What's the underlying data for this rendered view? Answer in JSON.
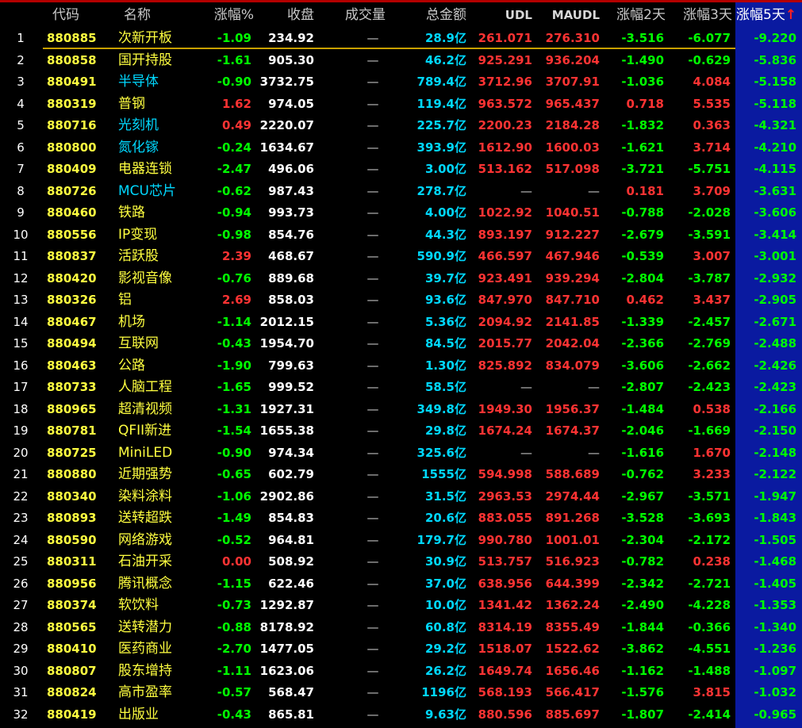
{
  "headers": {
    "code": "代码",
    "name": "名称",
    "change_pct": "涨幅%",
    "close": "收盘",
    "volume": "成交量",
    "total_amount": "总金额",
    "udl": "UDL",
    "maudl": "MAUDL",
    "change_2d": "涨幅2天",
    "change_3d": "涨幅3天",
    "change_5d": "涨幅5天",
    "sort_indicator": "↑"
  },
  "colors": {
    "background": "#000000",
    "selected_column": "#0a1aa0",
    "up": "#ff3333",
    "down": "#00ff00",
    "code": "#ffff40",
    "amount": "#00d8ff"
  },
  "rows": [
    {
      "num": "1",
      "code": "880885",
      "name": "次新开板",
      "chg": "-1.09",
      "close": "234.92",
      "vol": "—",
      "amt": "28.9亿",
      "udl": "261.071",
      "maudl": "276.310",
      "d2": "-3.516",
      "d3": "-6.077",
      "d5": "-9.220",
      "name_cyan": false
    },
    {
      "num": "2",
      "code": "880858",
      "name": "国开持股",
      "chg": "-1.61",
      "close": "905.30",
      "vol": "—",
      "amt": "46.2亿",
      "udl": "925.291",
      "maudl": "936.204",
      "d2": "-1.490",
      "d3": "-0.629",
      "d5": "-5.836",
      "name_cyan": false
    },
    {
      "num": "3",
      "code": "880491",
      "name": "半导体",
      "chg": "-0.90",
      "close": "3732.75",
      "vol": "—",
      "amt": "789.4亿",
      "udl": "3712.96",
      "maudl": "3707.91",
      "d2": "-1.036",
      "d3": "4.084",
      "d5": "-5.158",
      "name_cyan": true
    },
    {
      "num": "4",
      "code": "880319",
      "name": "普钢",
      "chg": "1.62",
      "close": "974.05",
      "vol": "—",
      "amt": "119.4亿",
      "udl": "963.572",
      "maudl": "965.437",
      "d2": "0.718",
      "d3": "5.535",
      "d5": "-5.118",
      "name_cyan": false
    },
    {
      "num": "5",
      "code": "880716",
      "name": "光刻机",
      "chg": "0.49",
      "close": "2220.07",
      "vol": "—",
      "amt": "225.7亿",
      "udl": "2200.23",
      "maudl": "2184.28",
      "d2": "-1.832",
      "d3": "0.363",
      "d5": "-4.321",
      "name_cyan": true
    },
    {
      "num": "6",
      "code": "880800",
      "name": "氮化镓",
      "chg": "-0.24",
      "close": "1634.67",
      "vol": "—",
      "amt": "393.9亿",
      "udl": "1612.90",
      "maudl": "1600.03",
      "d2": "-1.621",
      "d3": "3.714",
      "d5": "-4.210",
      "name_cyan": true
    },
    {
      "num": "7",
      "code": "880409",
      "name": "电器连锁",
      "chg": "-2.47",
      "close": "496.06",
      "vol": "—",
      "amt": "3.00亿",
      "udl": "513.162",
      "maudl": "517.098",
      "d2": "-3.721",
      "d3": "-5.751",
      "d5": "-4.115",
      "name_cyan": false
    },
    {
      "num": "8",
      "code": "880726",
      "name": "MCU芯片",
      "chg": "-0.62",
      "close": "987.43",
      "vol": "—",
      "amt": "278.7亿",
      "udl": "—",
      "maudl": "—",
      "d2": "0.181",
      "d3": "3.709",
      "d5": "-3.631",
      "name_cyan": true
    },
    {
      "num": "9",
      "code": "880460",
      "name": "铁路",
      "chg": "-0.94",
      "close": "993.73",
      "vol": "—",
      "amt": "4.00亿",
      "udl": "1022.92",
      "maudl": "1040.51",
      "d2": "-0.788",
      "d3": "-2.028",
      "d5": "-3.606",
      "name_cyan": false
    },
    {
      "num": "10",
      "code": "880556",
      "name": "IP变现",
      "chg": "-0.98",
      "close": "854.76",
      "vol": "—",
      "amt": "44.3亿",
      "udl": "893.197",
      "maudl": "912.227",
      "d2": "-2.679",
      "d3": "-3.591",
      "d5": "-3.414",
      "name_cyan": false
    },
    {
      "num": "11",
      "code": "880837",
      "name": "活跃股",
      "chg": "2.39",
      "close": "468.67",
      "vol": "—",
      "amt": "590.9亿",
      "udl": "466.597",
      "maudl": "467.946",
      "d2": "-0.539",
      "d3": "3.007",
      "d5": "-3.001",
      "name_cyan": false
    },
    {
      "num": "12",
      "code": "880420",
      "name": "影视音像",
      "chg": "-0.76",
      "close": "889.68",
      "vol": "—",
      "amt": "39.7亿",
      "udl": "923.491",
      "maudl": "939.294",
      "d2": "-2.804",
      "d3": "-3.787",
      "d5": "-2.932",
      "name_cyan": false
    },
    {
      "num": "13",
      "code": "880326",
      "name": "铝",
      "chg": "2.69",
      "close": "858.03",
      "vol": "—",
      "amt": "93.6亿",
      "udl": "847.970",
      "maudl": "847.710",
      "d2": "0.462",
      "d3": "3.437",
      "d5": "-2.905",
      "name_cyan": false
    },
    {
      "num": "14",
      "code": "880467",
      "name": "机场",
      "chg": "-1.14",
      "close": "2012.15",
      "vol": "—",
      "amt": "5.36亿",
      "udl": "2094.92",
      "maudl": "2141.85",
      "d2": "-1.339",
      "d3": "-2.457",
      "d5": "-2.671",
      "name_cyan": false
    },
    {
      "num": "15",
      "code": "880494",
      "name": "互联网",
      "chg": "-0.43",
      "close": "1954.70",
      "vol": "—",
      "amt": "84.5亿",
      "udl": "2015.77",
      "maudl": "2042.04",
      "d2": "-2.366",
      "d3": "-2.769",
      "d5": "-2.488",
      "name_cyan": false
    },
    {
      "num": "16",
      "code": "880463",
      "name": "公路",
      "chg": "-1.90",
      "close": "799.63",
      "vol": "—",
      "amt": "1.30亿",
      "udl": "825.892",
      "maudl": "834.079",
      "d2": "-3.606",
      "d3": "-2.662",
      "d5": "-2.426",
      "name_cyan": false
    },
    {
      "num": "17",
      "code": "880733",
      "name": "人脑工程",
      "chg": "-1.65",
      "close": "999.52",
      "vol": "—",
      "amt": "58.5亿",
      "udl": "—",
      "maudl": "—",
      "d2": "-2.807",
      "d3": "-2.423",
      "d5": "-2.423",
      "name_cyan": false
    },
    {
      "num": "18",
      "code": "880965",
      "name": "超清视频",
      "chg": "-1.31",
      "close": "1927.31",
      "vol": "—",
      "amt": "349.8亿",
      "udl": "1949.30",
      "maudl": "1956.37",
      "d2": "-1.484",
      "d3": "0.538",
      "d5": "-2.166",
      "name_cyan": false
    },
    {
      "num": "19",
      "code": "880781",
      "name": "QFII新进",
      "chg": "-1.54",
      "close": "1655.38",
      "vol": "—",
      "amt": "29.8亿",
      "udl": "1674.24",
      "maudl": "1674.37",
      "d2": "-2.046",
      "d3": "-1.669",
      "d5": "-2.150",
      "name_cyan": false
    },
    {
      "num": "20",
      "code": "880725",
      "name": "MiniLED",
      "chg": "-0.90",
      "close": "974.34",
      "vol": "—",
      "amt": "325.6亿",
      "udl": "—",
      "maudl": "—",
      "d2": "-1.616",
      "d3": "1.670",
      "d5": "-2.148",
      "name_cyan": false
    },
    {
      "num": "21",
      "code": "880880",
      "name": "近期强势",
      "chg": "-0.65",
      "close": "602.79",
      "vol": "—",
      "amt": "1555亿",
      "udl": "594.998",
      "maudl": "588.689",
      "d2": "-0.762",
      "d3": "3.233",
      "d5": "-2.122",
      "name_cyan": false
    },
    {
      "num": "22",
      "code": "880340",
      "name": "染料涂料",
      "chg": "-1.06",
      "close": "2902.86",
      "vol": "—",
      "amt": "31.5亿",
      "udl": "2963.53",
      "maudl": "2974.44",
      "d2": "-2.967",
      "d3": "-3.571",
      "d5": "-1.947",
      "name_cyan": false
    },
    {
      "num": "23",
      "code": "880893",
      "name": "送转超跌",
      "chg": "-1.49",
      "close": "854.83",
      "vol": "—",
      "amt": "20.6亿",
      "udl": "883.055",
      "maudl": "891.268",
      "d2": "-3.528",
      "d3": "-3.693",
      "d5": "-1.843",
      "name_cyan": false
    },
    {
      "num": "24",
      "code": "880590",
      "name": "网络游戏",
      "chg": "-0.52",
      "close": "964.81",
      "vol": "—",
      "amt": "179.7亿",
      "udl": "990.780",
      "maudl": "1001.01",
      "d2": "-2.304",
      "d3": "-2.172",
      "d5": "-1.505",
      "name_cyan": false
    },
    {
      "num": "25",
      "code": "880311",
      "name": "石油开采",
      "chg": "0.00",
      "close": "508.92",
      "vol": "—",
      "amt": "30.9亿",
      "udl": "513.757",
      "maudl": "516.923",
      "d2": "-0.782",
      "d3": "0.238",
      "d5": "-1.468",
      "name_cyan": false
    },
    {
      "num": "26",
      "code": "880956",
      "name": "腾讯概念",
      "chg": "-1.15",
      "close": "622.46",
      "vol": "—",
      "amt": "37.0亿",
      "udl": "638.956",
      "maudl": "644.399",
      "d2": "-2.342",
      "d3": "-2.721",
      "d5": "-1.405",
      "name_cyan": false
    },
    {
      "num": "27",
      "code": "880374",
      "name": "软饮料",
      "chg": "-0.73",
      "close": "1292.87",
      "vol": "—",
      "amt": "10.0亿",
      "udl": "1341.42",
      "maudl": "1362.24",
      "d2": "-2.490",
      "d3": "-4.228",
      "d5": "-1.353",
      "name_cyan": false
    },
    {
      "num": "28",
      "code": "880565",
      "name": "送转潜力",
      "chg": "-0.88",
      "close": "8178.92",
      "vol": "—",
      "amt": "60.8亿",
      "udl": "8314.19",
      "maudl": "8355.49",
      "d2": "-1.844",
      "d3": "-0.366",
      "d5": "-1.340",
      "name_cyan": false
    },
    {
      "num": "29",
      "code": "880410",
      "name": "医药商业",
      "chg": "-2.70",
      "close": "1477.05",
      "vol": "—",
      "amt": "29.2亿",
      "udl": "1518.07",
      "maudl": "1522.62",
      "d2": "-3.862",
      "d3": "-4.551",
      "d5": "-1.236",
      "name_cyan": false
    },
    {
      "num": "30",
      "code": "880807",
      "name": "股东增持",
      "chg": "-1.11",
      "close": "1623.06",
      "vol": "—",
      "amt": "26.2亿",
      "udl": "1649.74",
      "maudl": "1656.46",
      "d2": "-1.162",
      "d3": "-1.488",
      "d5": "-1.097",
      "name_cyan": false
    },
    {
      "num": "31",
      "code": "880824",
      "name": "高市盈率",
      "chg": "-0.57",
      "close": "568.47",
      "vol": "—",
      "amt": "1196亿",
      "udl": "568.193",
      "maudl": "566.417",
      "d2": "-1.576",
      "d3": "3.815",
      "d5": "-1.032",
      "name_cyan": false
    },
    {
      "num": "32",
      "code": "880419",
      "name": "出版业",
      "chg": "-0.43",
      "close": "865.81",
      "vol": "—",
      "amt": "9.63亿",
      "udl": "880.596",
      "maudl": "885.697",
      "d2": "-1.807",
      "d3": "-2.414",
      "d5": "-0.965",
      "name_cyan": false
    }
  ]
}
